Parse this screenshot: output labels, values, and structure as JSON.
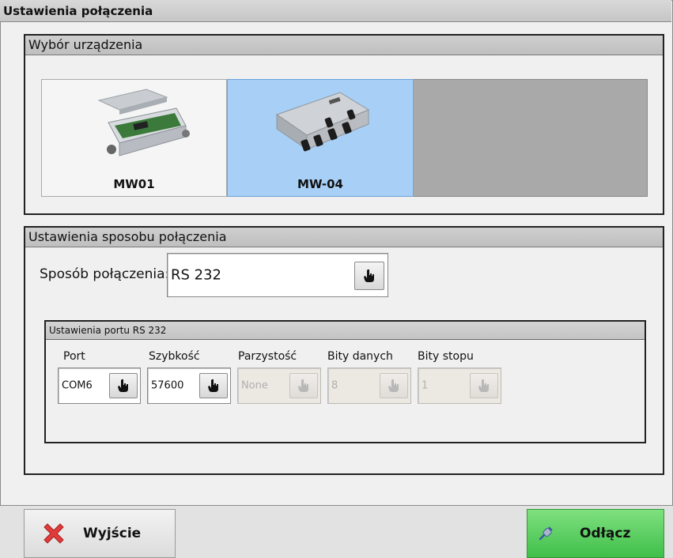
{
  "window": {
    "title": "Ustawienia połączenia"
  },
  "device_selection": {
    "title": "Wybór urządzenia",
    "devices": [
      {
        "name": "MW01",
        "selected": false
      },
      {
        "name": "MW-04",
        "selected": true
      }
    ]
  },
  "connection": {
    "title": "Ustawienia sposobu połączenia",
    "method_label": "Sposób połączenia:",
    "method_value": "RS 232",
    "port_settings": {
      "title": "Ustawienia portu RS 232",
      "fields": [
        {
          "label": "Port",
          "value": "COM6",
          "enabled": true
        },
        {
          "label": "Szybkość",
          "value": "57600",
          "enabled": true
        },
        {
          "label": "Parzystość",
          "value": "None",
          "enabled": false
        },
        {
          "label": "Bity danych",
          "value": "8",
          "enabled": false
        },
        {
          "label": "Bity stopu",
          "value": "1",
          "enabled": false
        }
      ]
    }
  },
  "footer": {
    "exit_label": "Wyjście",
    "disconnect_label": "Odłącz"
  },
  "colors": {
    "selected_device": "#a8cff5",
    "disconnect_button": "#4fca57",
    "exit_icon": "#e23b3b"
  },
  "icons": [
    "hand-pointer-icon",
    "close-x-icon",
    "plug-icon"
  ]
}
